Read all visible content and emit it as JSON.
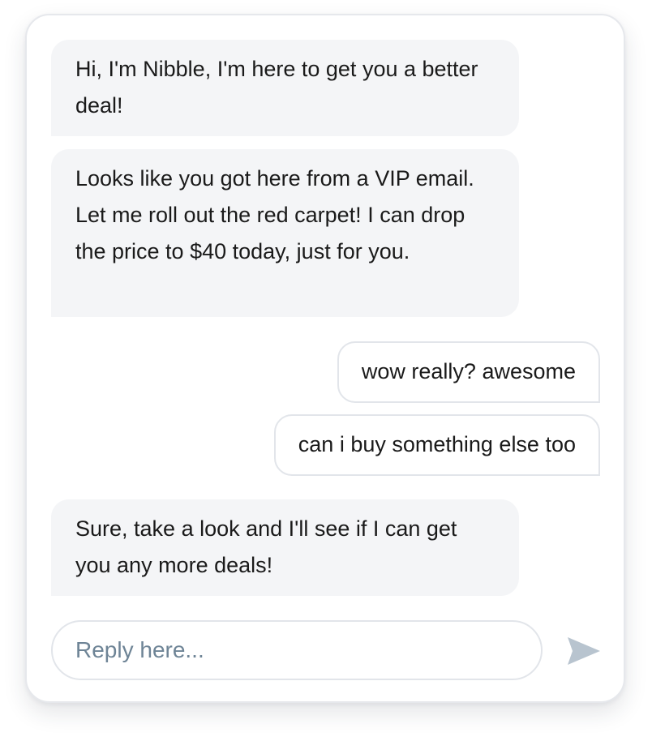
{
  "messages": [
    {
      "sender": "bot",
      "text": "Hi, I'm Nibble, I'm here to get you a better deal!"
    },
    {
      "sender": "bot",
      "text": "Looks like you got here from a VIP email. Let me roll out the red carpet! I can drop the price to $40 today, just for you."
    },
    {
      "sender": "user",
      "text": "wow really? awesome"
    },
    {
      "sender": "user",
      "text": "can i buy something else too"
    },
    {
      "sender": "bot",
      "text": "Sure, take a look and I'll see if I can get you any more deals!"
    }
  ],
  "composer": {
    "placeholder": "Reply here...",
    "value": "",
    "send_icon": "send-icon"
  },
  "colors": {
    "bot_bubble": "#f4f5f7",
    "user_bubble_border": "#e2e5ea",
    "placeholder": "#6e8496",
    "send_icon": "#b8c4cf",
    "card_border": "#e6e8ec"
  }
}
